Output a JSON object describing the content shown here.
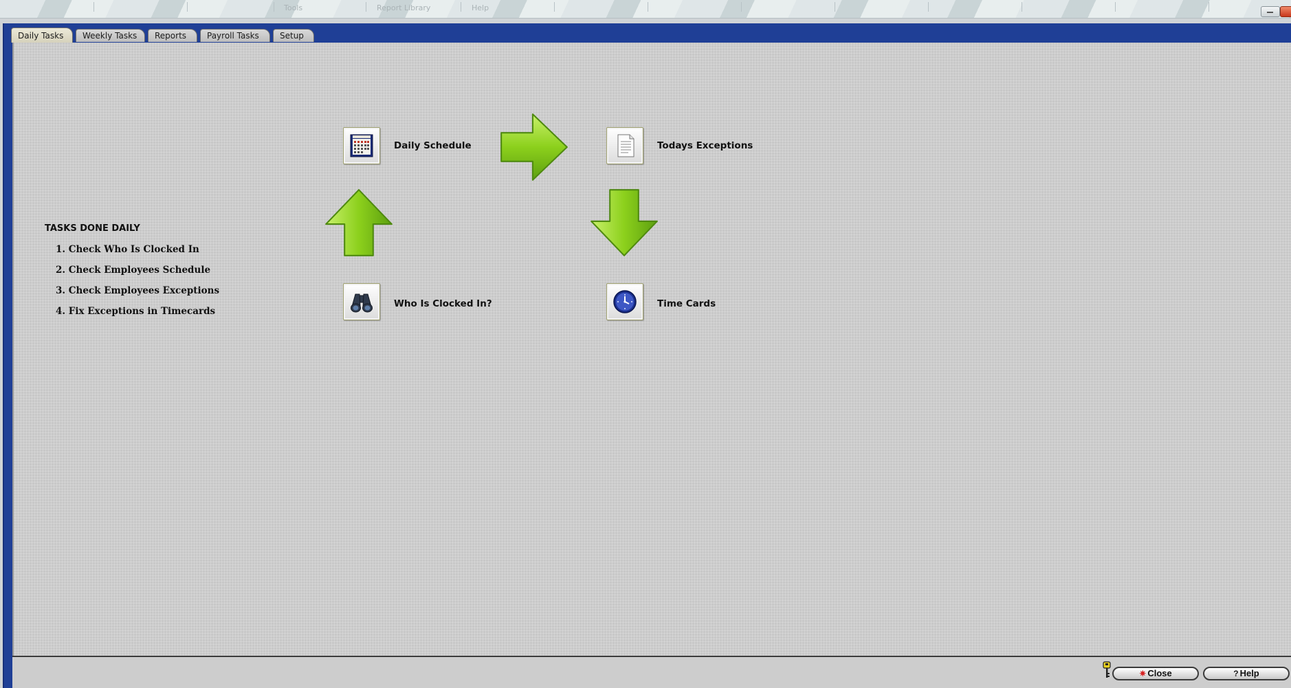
{
  "menu": {
    "items": [
      "Tools",
      "Report Library",
      "Help"
    ]
  },
  "tabs": [
    {
      "label": "Daily Tasks",
      "active": true
    },
    {
      "label": "Weekly Tasks",
      "active": false
    },
    {
      "label": "Reports",
      "active": false
    },
    {
      "label": "Payroll Tasks",
      "active": false
    },
    {
      "label": "Setup",
      "active": false
    }
  ],
  "tasks_panel": {
    "title": "TASKS DONE DAILY",
    "items": [
      "1. Check Who Is Clocked In",
      "2. Check Employees Schedule",
      "3. Check Employees Exceptions",
      "4. Fix Exceptions in Timecards"
    ]
  },
  "workflow": {
    "daily_schedule": {
      "label": "Daily Schedule",
      "icon": "calendar-icon"
    },
    "todays_exceptions": {
      "label": "Todays Exceptions",
      "icon": "document-icon"
    },
    "who_is_clocked_in": {
      "label": "Who Is Clocked In?",
      "icon": "binoculars-icon"
    },
    "time_cards": {
      "label": "Time Cards",
      "icon": "clock-icon"
    }
  },
  "footer": {
    "close_label": "Close",
    "help_label": "Help",
    "close_glyph": "✷",
    "help_glyph": "?"
  },
  "colors": {
    "frame_blue": "#1f3f96",
    "arrow_green": "#8cd01c",
    "panel_gray": "#cdcdcd"
  }
}
